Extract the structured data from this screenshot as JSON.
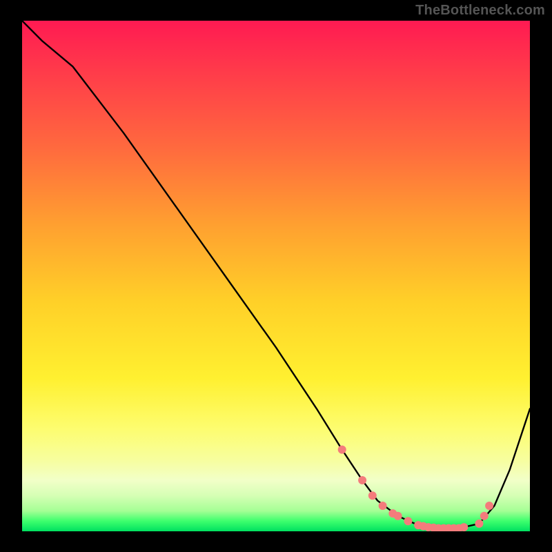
{
  "watermark": "TheBottleneck.com",
  "chart_data": {
    "type": "line",
    "title": "",
    "xlabel": "",
    "ylabel": "",
    "xlim": [
      0,
      100
    ],
    "ylim": [
      0,
      100
    ],
    "grid": false,
    "legend": false,
    "series": [
      {
        "name": "curve",
        "x": [
          0,
          4,
          10,
          20,
          30,
          40,
          50,
          58,
          63,
          67,
          70,
          74,
          78,
          82,
          86,
          90,
          93,
          96,
          100
        ],
        "y": [
          100,
          96,
          91,
          78,
          64,
          50,
          36,
          24,
          16,
          10,
          6,
          3,
          1.2,
          0.6,
          0.6,
          1.5,
          5,
          12,
          24
        ]
      }
    ],
    "markers": {
      "name": "dot-cluster",
      "x": [
        63,
        67,
        69,
        71,
        73,
        74,
        76,
        78,
        79,
        80,
        81,
        82,
        83,
        84,
        85,
        86,
        87,
        90,
        91,
        92
      ],
      "y": [
        16,
        10,
        7,
        5,
        3.5,
        3,
        2,
        1.2,
        1,
        0.8,
        0.7,
        0.6,
        0.6,
        0.6,
        0.6,
        0.6,
        0.8,
        1.5,
        3,
        5
      ],
      "color": "#f47c7c",
      "radius": 6
    },
    "background_gradient": {
      "direction": "vertical",
      "stops": [
        {
          "pos": 0.0,
          "color": "#ff1a52"
        },
        {
          "pos": 0.25,
          "color": "#ff6a3e"
        },
        {
          "pos": 0.55,
          "color": "#ffd028"
        },
        {
          "pos": 0.8,
          "color": "#fdfd70"
        },
        {
          "pos": 0.93,
          "color": "#d6ffb5"
        },
        {
          "pos": 1.0,
          "color": "#00e060"
        }
      ]
    }
  }
}
